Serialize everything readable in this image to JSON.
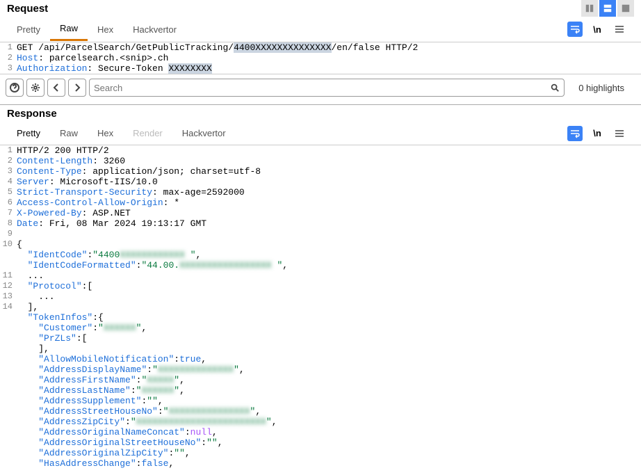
{
  "request": {
    "title": "Request",
    "tabs": [
      "Pretty",
      "Raw",
      "Hex",
      "Hackvertor"
    ],
    "active_tab": "Raw",
    "lines": [
      {
        "n": "1",
        "html": "GET /api/ParcelSearch/GetPublicTracking/<span class='hl'>4400XXXXXXXXXXXXXX</span>/en/false HTTP/2"
      },
      {
        "n": "2",
        "html": "<span class='hdr'>Host</span>: parcelsearch.&lt;snip&gt;.ch"
      },
      {
        "n": "3",
        "html": "<span class='hdr'>Authorization</span>: Secure-Token <span class='hl'>XXXXXXXX</span>"
      }
    ]
  },
  "toolbar": {
    "search_placeholder": "Search",
    "highlights": "0 highlights"
  },
  "response": {
    "title": "Response",
    "tabs": [
      "Pretty",
      "Raw",
      "Hex",
      "Render",
      "Hackvertor"
    ],
    "active_tab": "Pretty",
    "lines": [
      {
        "n": "1",
        "html": "HTTP/2 200 HTTP/2"
      },
      {
        "n": "2",
        "html": "<span class='hdr'>Content-Length</span>: 3260"
      },
      {
        "n": "3",
        "html": "<span class='hdr'>Content-Type</span>: application/json; charset=utf-8"
      },
      {
        "n": "4",
        "html": "<span class='hdr'>Server</span>: Microsoft-IIS/10.0"
      },
      {
        "n": "5",
        "html": "<span class='hdr'>Strict-Transport-Security</span>: max-age=2592000"
      },
      {
        "n": "6",
        "html": "<span class='hdr'>Access-Control-Allow-Origin</span>: *"
      },
      {
        "n": "7",
        "html": "<span class='hdr'>X-Powered-By</span>: ASP.NET"
      },
      {
        "n": "8",
        "html": "<span class='hdr'>Date</span>: Fri, 08 Mar 2024 19:13:17 GMT"
      },
      {
        "n": "9",
        "html": ""
      },
      {
        "n": "10",
        "html": "{"
      },
      {
        "n": "",
        "html": "  <span class='key'>\"IdentCode\"</span>:<span class='str'>\"4400<span class='blur'>XXXXXXXXXXXX</span> \"</span>,"
      },
      {
        "n": "",
        "html": "  <span class='key'>\"IdentCodeFormatted\"</span>:<span class='str'>\"44.00.<span class='blur'>XXXXXXXXXXXXXXXXX</span> \"</span>,"
      },
      {
        "n": "11",
        "html": "  ..."
      },
      {
        "n": "12",
        "html": "  <span class='key'>\"Protocol\"</span>:["
      },
      {
        "n": "13",
        "html": "    ..."
      },
      {
        "n": "14",
        "html": "  ],"
      },
      {
        "n": "",
        "html": "  <span class='key'>\"TokenInfos\"</span>:{"
      },
      {
        "n": "",
        "html": "    <span class='key'>\"Customer\"</span>:<span class='str'>\"<span class='blur'>XXXXXX</span>\"</span>,"
      },
      {
        "n": "",
        "html": "    <span class='key'>\"PrZLs\"</span>:["
      },
      {
        "n": "",
        "html": "    ],"
      },
      {
        "n": "",
        "html": "    <span class='key'>\"AllowMobileNotification\"</span>:<span class='num'>true</span>,"
      },
      {
        "n": "",
        "html": "    <span class='key'>\"AddressDisplayName\"</span>:<span class='str'>\"<span class='blur'>XXXXXXXXXXXXXX</span>\"</span>,"
      },
      {
        "n": "",
        "html": "    <span class='key'>\"AddressFirstName\"</span>:<span class='str'>\"<span class='blur'>XXXXX</span>\"</span>,"
      },
      {
        "n": "",
        "html": "    <span class='key'>\"AddressLastName\"</span>:<span class='str'>\"<span class='blur'>XXXXXX</span>\"</span>,"
      },
      {
        "n": "",
        "html": "    <span class='key'>\"AddressSupplement\"</span>:<span class='str'>\"\"</span>,"
      },
      {
        "n": "",
        "html": "    <span class='key'>\"AddressStreetHouseNo\"</span>:<span class='str'>\"<span class='blur'>XXXXXXXXXXXXXXX</span>\"</span>,"
      },
      {
        "n": "",
        "html": "    <span class='key'>\"AddressZipCity\"</span>:<span class='str'>\"<span class='blur'>XXXXXXXXXXXXXXXXXXXXXXXX</span>\"</span>,"
      },
      {
        "n": "",
        "html": "    <span class='key'>\"AddressOriginalNameConcat\"</span>:<span class='null'>null</span>,"
      },
      {
        "n": "",
        "html": "    <span class='key'>\"AddressOriginalStreetHouseNo\"</span>:<span class='str'>\"\"</span>,"
      },
      {
        "n": "",
        "html": "    <span class='key'>\"AddressOriginalZipCity\"</span>:<span class='str'>\"\"</span>,"
      },
      {
        "n": "",
        "html": "    <span class='key'>\"HasAddressChange\"</span>:<span class='num'>false</span>,"
      }
    ]
  }
}
